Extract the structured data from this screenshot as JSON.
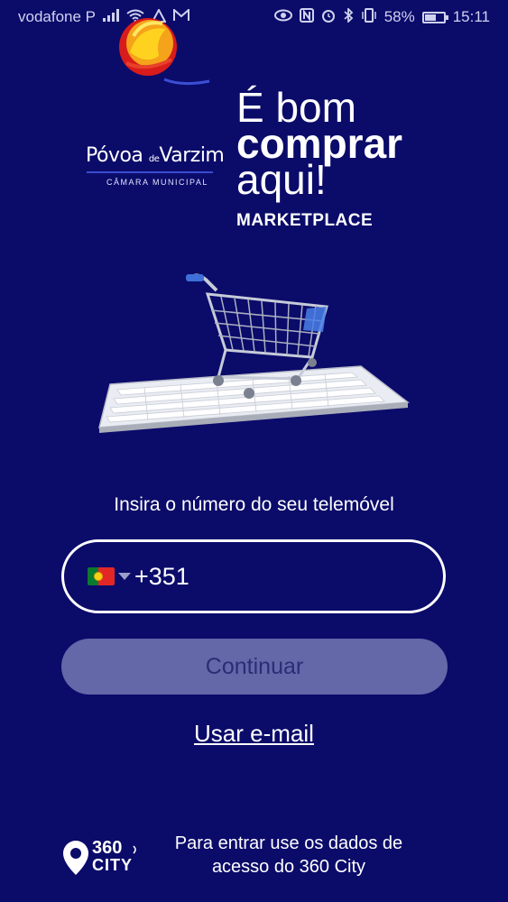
{
  "status_bar": {
    "carrier": "vodafone P",
    "battery_percent": "58%",
    "time": "15:11",
    "battery_level": 0.58,
    "icons_left": [
      "signal-icon",
      "wifi-icon",
      "sync-icon",
      "mail-icon"
    ],
    "icons_right": [
      "eye-icon",
      "nfc-icon",
      "alarm-icon",
      "bluetooth-icon",
      "vibrate-icon",
      "battery-icon"
    ]
  },
  "branding": {
    "municipality_name_a": "Póvoa",
    "municipality_name_de": "de",
    "municipality_name_b": "Varzim",
    "municipality_subtitle": "CÂMARA MUNICIPAL",
    "slogan_line1": "É bom",
    "slogan_line2": "comprar",
    "slogan_line3": "aqui!",
    "product": "MARKETPLACE"
  },
  "login": {
    "prompt": "Insira o número do seu telemóvel",
    "country_flag": "portugal-flag",
    "dial_code": "+351",
    "continue_label": "Continuar",
    "email_link": "Usar e-mail"
  },
  "footer": {
    "logo_top": "360",
    "logo_bottom": "CITY",
    "text": "Para entrar use os dados de acesso do 360 City"
  },
  "colors": {
    "background": "#0b0b6a",
    "button_disabled": "#6467a8",
    "text": "#ffffff"
  }
}
